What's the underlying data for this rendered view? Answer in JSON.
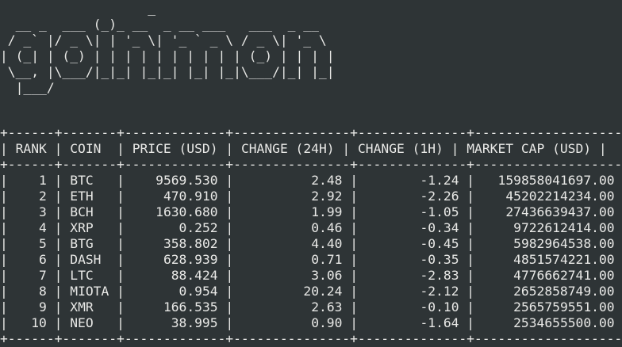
{
  "logo_lines": [
    "                   _",
    "  __ _  ___ (_)_ __  _ __ ___   ___  _ __",
    " / _` |/ _ \\| | '_ \\| '_ ` _ \\ / _ \\| '_ \\",
    "| (_| | (_) | | | | | | | | | | (_) | | | |",
    " \\__, |\\___/|_|_| |_|_| |_| |_|\\___/|_| |_|",
    "  |___/"
  ],
  "table": {
    "border": "+------+-------+-------------+---------------+--------------+-------------------+",
    "columns": [
      "RANK",
      "COIN",
      "PRICE (USD)",
      "CHANGE (24H)",
      "CHANGE (1H)",
      "MARKET CAP (USD)"
    ],
    "rows": [
      [
        "1",
        "BTC",
        "9569.530",
        "2.48",
        "-1.24",
        "159858041697.00"
      ],
      [
        "2",
        "ETH",
        "470.910",
        "2.92",
        "-2.26",
        "45202214234.00"
      ],
      [
        "3",
        "BCH",
        "1630.680",
        "1.99",
        "-1.05",
        "27436639437.00"
      ],
      [
        "4",
        "XRP",
        "0.252",
        "0.46",
        "-0.34",
        "9722612414.00"
      ],
      [
        "5",
        "BTG",
        "358.802",
        "4.40",
        "-0.45",
        "5982964538.00"
      ],
      [
        "6",
        "DASH",
        "628.939",
        "0.71",
        "-0.35",
        "4851574221.00"
      ],
      [
        "7",
        "LTC",
        "88.424",
        "3.06",
        "-2.83",
        "4776662741.00"
      ],
      [
        "8",
        "MIOTA",
        "0.954",
        "20.24",
        "-2.12",
        "2652858749.00"
      ],
      [
        "9",
        "XMR",
        "166.535",
        "2.63",
        "-0.10",
        "2565759551.00"
      ],
      [
        "10",
        "NEO",
        "38.995",
        "0.90",
        "-1.64",
        "2534655500.00"
      ]
    ]
  },
  "colors": {
    "background": "#2e3436",
    "text": "#e8e8e6"
  }
}
